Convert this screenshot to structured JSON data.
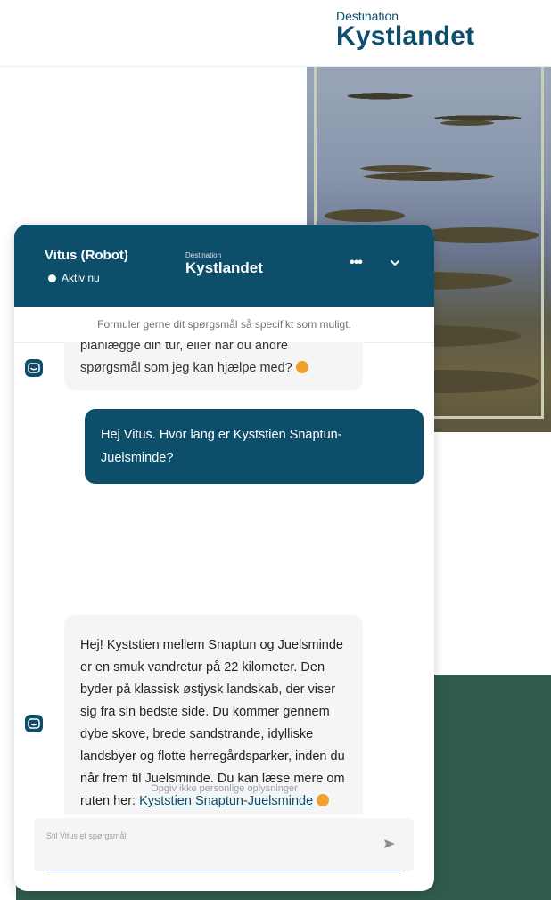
{
  "site": {
    "brand_small": "Destination",
    "brand_big": "Kystlandet"
  },
  "chat": {
    "agent_name": "Vitus (Robot)",
    "status": "Aktiv nu",
    "header_brand_small": "Destination",
    "header_brand_big": "Kystlandet",
    "more_label": "•••",
    "notice": "Formuler gerne dit spørgsmål så specifikt som muligt.",
    "messages": [
      {
        "role": "bot",
        "text_line_1": "planlægge din tur, eller har du andre",
        "text_line_2": "spørgsmål som jeg kan hjælpe med?"
      },
      {
        "role": "user",
        "text": "Hej Vitus. Hvor lang er Kyststien Snaptun-Juelsminde?"
      },
      {
        "role": "bot",
        "text": "Hej! Kyststien mellem Snaptun og Juelsminde er en smuk vandretur på 22 kilometer. Den byder på klassisk østjysk landskab, der viser sig fra sin bedste side. Du kommer gennem dybe skove, brede sandstrande, idylliske landsbyer og flotte herregårdsparker, inden du når frem til Juelsminde. Du kan læse mere om ruten her: ",
        "link_text": "Kyststien Snaptun-Juelsminde"
      }
    ],
    "privacy_note": "Opgiv ikke personlige oplysninger",
    "input_placeholder": "Stil Vitus et spørgsmål",
    "input_value": ""
  },
  "colors": {
    "brand": "#0d4e6b",
    "footer_green": "#2f5b4d",
    "bubble_bg": "#f5f5f5",
    "emoji": "#f2a02d"
  },
  "icons": {
    "collapse": "chevron-down-icon",
    "send": "send-icon",
    "avatar": "robot-smile-icon",
    "status": "status-dot-icon"
  }
}
